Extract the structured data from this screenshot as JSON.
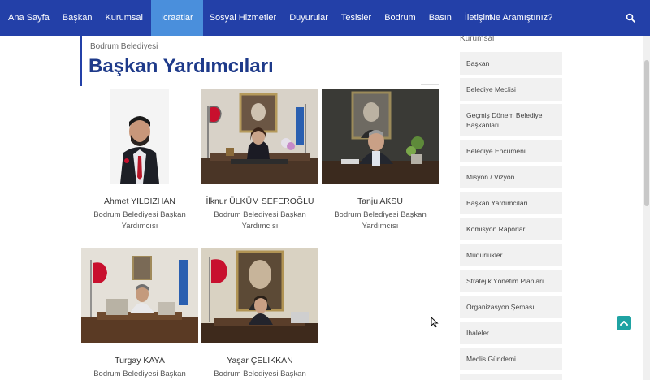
{
  "nav": {
    "items": [
      {
        "label": "Ana Sayfa",
        "active": false
      },
      {
        "label": "Başkan",
        "active": false
      },
      {
        "label": "Kurumsal",
        "active": false
      },
      {
        "label": "İcraatlar",
        "active": true
      },
      {
        "label": "Sosyal Hizmetler",
        "active": false
      },
      {
        "label": "Duyurular",
        "active": false
      },
      {
        "label": "Tesisler",
        "active": false
      },
      {
        "label": "Bodrum",
        "active": false
      },
      {
        "label": "Basın",
        "active": false
      },
      {
        "label": "İletişim",
        "active": false
      }
    ],
    "search_placeholder": "Ne Aramıştınız?",
    "bar_color": "#2340a8",
    "active_color": "#4a8fdc"
  },
  "header": {
    "breadcrumb": "Bodrum Belediyesi",
    "title": "Başkan Yardımcıları"
  },
  "people": [
    {
      "name": "Ahmet YILDIZHAN",
      "role": "Bodrum Belediyesi Başkan Yardımcısı"
    },
    {
      "name": "İlknur ÜLKÜM SEFEROĞLU",
      "role": "Bodrum Belediyesi Başkan Yardımcısı"
    },
    {
      "name": "Tanju AKSU",
      "role": "Bodrum Belediyesi Başkan Yardımcısı"
    },
    {
      "name": "Turgay KAYA",
      "role": "Bodrum Belediyesi Başkan"
    },
    {
      "name": "Yaşar ÇELİKKAN",
      "role": "Bodrum Belediyesi Başkan"
    }
  ],
  "sidebar": {
    "heading": "Kurumsal",
    "items": [
      "Başkan",
      "Belediye Meclisi",
      "Geçmiş Dönem Belediye Başkanları",
      "Belediye Encümeni",
      "Misyon / Vizyon",
      "Başkan Yardımcıları",
      "Komisyon Raporları",
      "Müdürlükler",
      "Stratejik Yönetim Planları",
      "Organizasyon Şeması",
      "İhaleler",
      "Meclis Gündemi"
    ]
  },
  "icons": {
    "search": "search-icon",
    "back_to_top": "chevron-up-icon",
    "cursor": "mouse-cursor-icon"
  }
}
